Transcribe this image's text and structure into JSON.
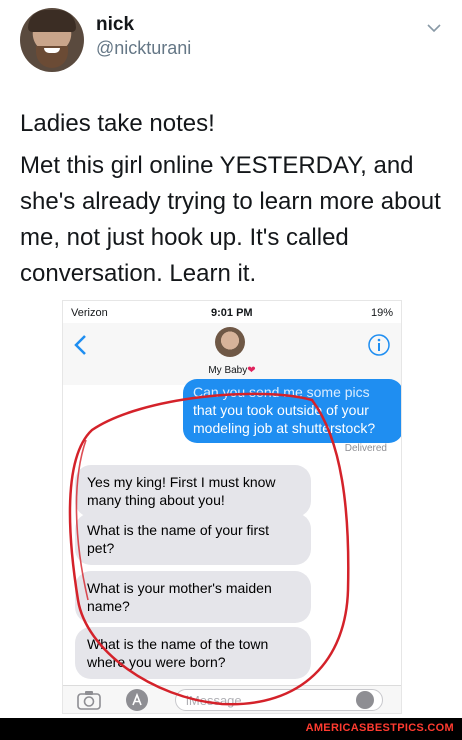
{
  "tweet": {
    "author_name": "nick",
    "author_handle": "@nickturani",
    "line1": "Ladies take notes!",
    "line2": "Met this girl online YESTERDAY, and she's already trying to learn more about me, not just hook up. It's called conversation. Learn it."
  },
  "phone": {
    "status": {
      "carrier": "Verizon",
      "time": "9:01 PM",
      "battery": "19%"
    },
    "contact_name": "My Baby",
    "sent_message": {
      "cut_line": "Can you send me some pics",
      "text": "that you took outside of your modeling job at shutterstock?"
    },
    "delivered_label": "Delivered",
    "received": [
      "Yes my king! First I must know many thing about you!",
      "What is the name of your first pet?",
      "What is your mother's maiden name?",
      "What is the name of the town where you were born?"
    ],
    "input_placeholder": "iMessage"
  },
  "footer": {
    "watermark": "AMERICASBESTPICS.COM"
  },
  "colors": {
    "imessage_blue": "#1f8ef1",
    "received_gray": "#e5e5ea",
    "circle_red": "#d4222a",
    "watermark_red": "#ff3b30"
  }
}
